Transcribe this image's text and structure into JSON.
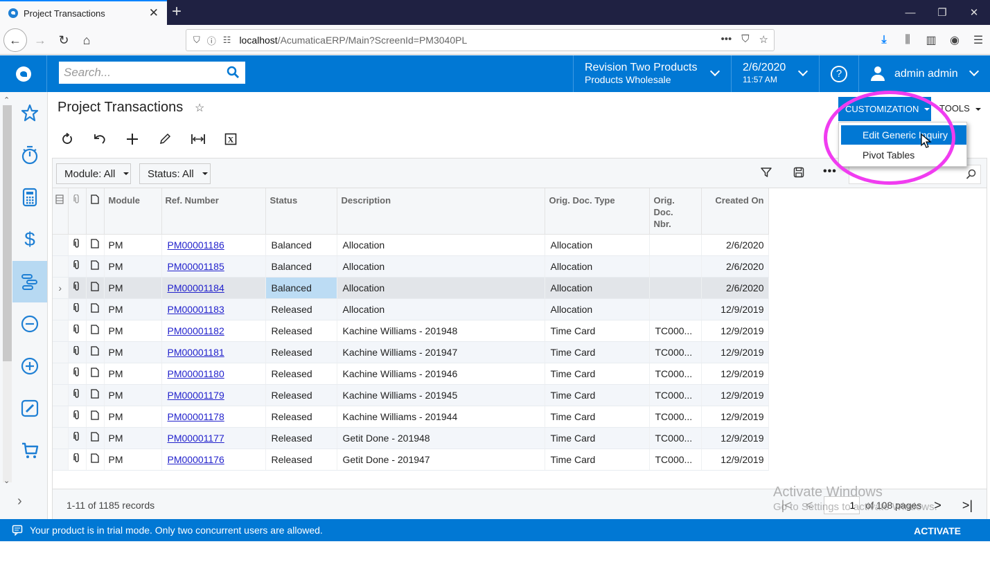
{
  "browser": {
    "tab_title": "Project Transactions",
    "url_host": "localhost",
    "url_path": "/AcumaticaERP/Main?ScreenId=PM3040PL"
  },
  "header": {
    "search_placeholder": "Search...",
    "company_name": "Revision Two Products",
    "branch_name": "Products Wholesale",
    "date": "2/6/2020",
    "time": "11:57 AM",
    "user": "admin admin"
  },
  "sidebar": {
    "items": [
      {
        "icon": "star-icon",
        "label": "Favorites"
      },
      {
        "icon": "timer-icon",
        "label": "Time"
      },
      {
        "icon": "calculator-icon",
        "label": "Finance"
      },
      {
        "icon": "dollar-icon",
        "label": "Banking"
      },
      {
        "icon": "projects-icon",
        "label": "Projects",
        "active": true
      },
      {
        "icon": "minus-circle-icon",
        "label": "Payables"
      },
      {
        "icon": "plus-circle-icon",
        "label": "Receivables"
      },
      {
        "icon": "edit-icon",
        "label": "Sales Orders"
      },
      {
        "icon": "cart-icon",
        "label": "Purchases"
      }
    ]
  },
  "page": {
    "title": "Project Transactions",
    "customization_label": "CUSTOMIZATION",
    "tools_label": "TOOLS",
    "customization_menu": [
      "Edit Generic Inquiry",
      "Pivot Tables"
    ]
  },
  "filters": {
    "module": "Module: All",
    "status": "Status: All"
  },
  "grid": {
    "columns": [
      "Module",
      "Ref. Number",
      "Status",
      "Description",
      "Orig. Doc. Type",
      "Orig. Doc. Nbr.",
      "Created On"
    ],
    "rows": [
      {
        "module": "PM",
        "ref": "PM00001186",
        "status": "Balanced",
        "description": "Allocation",
        "orig_type": "Allocation",
        "orig_nbr": "",
        "created": "2/6/2020"
      },
      {
        "module": "PM",
        "ref": "PM00001185",
        "status": "Balanced",
        "description": "Allocation",
        "orig_type": "Allocation",
        "orig_nbr": "",
        "created": "2/6/2020"
      },
      {
        "module": "PM",
        "ref": "PM00001184",
        "status": "Balanced",
        "description": "Allocation",
        "orig_type": "Allocation",
        "orig_nbr": "",
        "created": "2/6/2020"
      },
      {
        "module": "PM",
        "ref": "PM00001183",
        "status": "Released",
        "description": "Allocation",
        "orig_type": "Allocation",
        "orig_nbr": "",
        "created": "12/9/2019"
      },
      {
        "module": "PM",
        "ref": "PM00001182",
        "status": "Released",
        "description": "Kachine Williams - 201948",
        "orig_type": "Time Card",
        "orig_nbr": "TC000...",
        "created": "12/9/2019"
      },
      {
        "module": "PM",
        "ref": "PM00001181",
        "status": "Released",
        "description": "Kachine Williams - 201947",
        "orig_type": "Time Card",
        "orig_nbr": "TC000...",
        "created": "12/9/2019"
      },
      {
        "module": "PM",
        "ref": "PM00001180",
        "status": "Released",
        "description": "Kachine Williams - 201946",
        "orig_type": "Time Card",
        "orig_nbr": "TC000...",
        "created": "12/9/2019"
      },
      {
        "module": "PM",
        "ref": "PM00001179",
        "status": "Released",
        "description": "Kachine Williams - 201945",
        "orig_type": "Time Card",
        "orig_nbr": "TC000...",
        "created": "12/9/2019"
      },
      {
        "module": "PM",
        "ref": "PM00001178",
        "status": "Released",
        "description": "Kachine Williams - 201944",
        "orig_type": "Time Card",
        "orig_nbr": "TC000...",
        "created": "12/9/2019"
      },
      {
        "module": "PM",
        "ref": "PM00001177",
        "status": "Released",
        "description": "Getit Done - 201948",
        "orig_type": "Time Card",
        "orig_nbr": "TC000...",
        "created": "12/9/2019"
      },
      {
        "module": "PM",
        "ref": "PM00001176",
        "status": "Released",
        "description": "Getit Done - 201947",
        "orig_type": "Time Card",
        "orig_nbr": "TC000...",
        "created": "12/9/2019"
      }
    ],
    "current_row_index": 2
  },
  "footer": {
    "records": "1-11 of 1185 records",
    "page": "1",
    "pages": "of 108 pages"
  },
  "watermark": {
    "line1": "Activate Windows",
    "line2": "Go to Settings to activate Windows."
  },
  "trial": {
    "message": "Your product is in trial mode. Only two concurrent users are allowed.",
    "activate_label": "ACTIVATE"
  },
  "colors": {
    "brand": "#0178d4",
    "highlight_ellipse": "#f03cf0",
    "link": "#2222cc"
  }
}
